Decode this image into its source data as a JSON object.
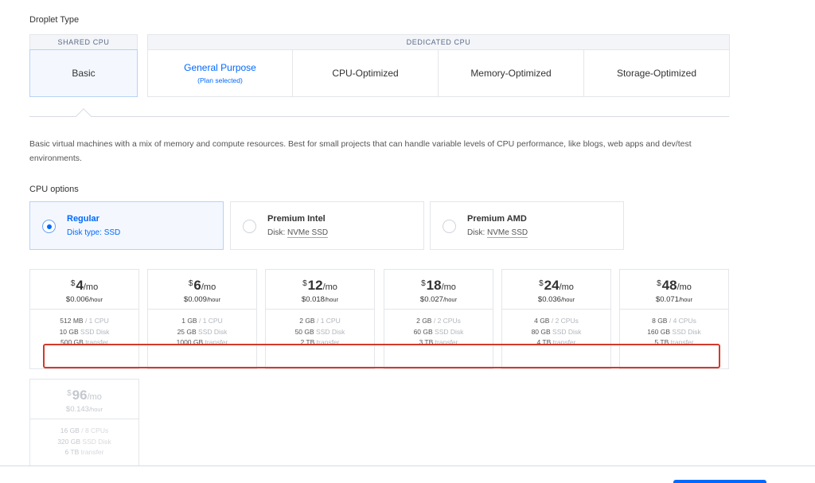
{
  "droplet_type": {
    "title": "Droplet Type",
    "shared_header": "SHARED CPU",
    "dedicated_header": "DEDICATED CPU",
    "options": [
      {
        "label": "Basic",
        "sub": ""
      },
      {
        "label": "General Purpose",
        "sub": "(Plan selected)"
      },
      {
        "label": "CPU-Optimized",
        "sub": ""
      },
      {
        "label": "Memory-Optimized",
        "sub": ""
      },
      {
        "label": "Storage-Optimized",
        "sub": ""
      }
    ],
    "selected": "Basic"
  },
  "description": "Basic virtual machines with a mix of memory and compute resources. Best for small projects that can handle variable levels of CPU performance, like blogs, web apps and dev/test environments.",
  "cpu_options": {
    "title": "CPU options",
    "options": [
      {
        "name": "Regular",
        "disk_label": "Disk type: ",
        "disk": "SSD"
      },
      {
        "name": "Premium Intel",
        "disk_label": "Disk: ",
        "disk": "NVMe SSD"
      },
      {
        "name": "Premium AMD",
        "disk_label": "Disk: ",
        "disk": "NVMe SSD"
      }
    ],
    "selected": "Regular"
  },
  "plans": [
    {
      "currency": "$",
      "price": "4",
      "per": "/mo",
      "hourly": "$0.006",
      "hour_unit": "/hour",
      "memory": "512 MB",
      "cpu": "/ 1 CPU",
      "disk": "10 GB",
      "disk_unit": "SSD Disk",
      "transfer": "500 GB",
      "transfer_unit": "transfer"
    },
    {
      "currency": "$",
      "price": "6",
      "per": "/mo",
      "hourly": "$0.009",
      "hour_unit": "/hour",
      "memory": "1 GB",
      "cpu": "/ 1 CPU",
      "disk": "25 GB",
      "disk_unit": "SSD Disk",
      "transfer": "1000 GB",
      "transfer_unit": "transfer"
    },
    {
      "currency": "$",
      "price": "12",
      "per": "/mo",
      "hourly": "$0.018",
      "hour_unit": "/hour",
      "memory": "2 GB",
      "cpu": "/ 1 CPU",
      "disk": "50 GB",
      "disk_unit": "SSD Disk",
      "transfer": "2 TB",
      "transfer_unit": "transfer"
    },
    {
      "currency": "$",
      "price": "18",
      "per": "/mo",
      "hourly": "$0.027",
      "hour_unit": "/hour",
      "memory": "2 GB",
      "cpu": "/ 2 CPUs",
      "disk": "60 GB",
      "disk_unit": "SSD Disk",
      "transfer": "3 TB",
      "transfer_unit": "transfer"
    },
    {
      "currency": "$",
      "price": "24",
      "per": "/mo",
      "hourly": "$0.036",
      "hour_unit": "/hour",
      "memory": "4 GB",
      "cpu": "/ 2 CPUs",
      "disk": "80 GB",
      "disk_unit": "SSD Disk",
      "transfer": "4 TB",
      "transfer_unit": "transfer"
    },
    {
      "currency": "$",
      "price": "48",
      "per": "/mo",
      "hourly": "$0.071",
      "hour_unit": "/hour",
      "memory": "8 GB",
      "cpu": "/ 4 CPUs",
      "disk": "160 GB",
      "disk_unit": "SSD Disk",
      "transfer": "5 TB",
      "transfer_unit": "transfer"
    },
    {
      "currency": "$",
      "price": "96",
      "per": "/mo",
      "hourly": "$0.143",
      "hour_unit": "/hour",
      "memory": "16 GB",
      "cpu": "/ 8 CPUs",
      "disk": "320 GB",
      "disk_unit": "SSD Disk",
      "transfer": "6 TB",
      "transfer_unit": "transfer"
    }
  ],
  "colors": {
    "accent": "#0069ff",
    "highlight": "#d23a2c"
  }
}
